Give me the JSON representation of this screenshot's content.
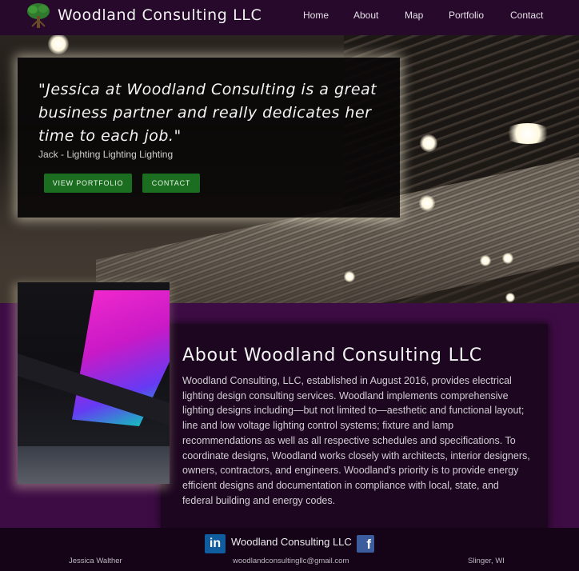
{
  "header": {
    "site_title": "Woodland Consulting LLC",
    "logo_icon": "tree-icon",
    "nav": [
      "Home",
      "About",
      "Map",
      "Portfolio",
      "Contact"
    ]
  },
  "hero": {
    "quote": "\"Jessica at Woodland Consulting is a great business partner and really dedicates her time to each job.\"",
    "author": "Jack - Lighting Lighting Lighting",
    "buttons": {
      "portfolio": "VIEW PORTFOLIO",
      "contact": "CONTACT"
    },
    "button_color": "#1b6d1f"
  },
  "about": {
    "title": "About Woodland Consulting LLC",
    "body": "Woodland Consulting, LLC, established in August 2016, provides electrical lighting design consulting services. Woodland implements comprehensive lighting designs including—but not limited to—aesthetic and functional layout; line and low voltage lighting control systems; fixture and lamp recommendations as well as all respective schedules and specifications. To coordinate designs, Woodland works closely with architects, interior designers, owners, contractors, and engineers. Woodland's priority is to provide energy efficient designs and documentation in compliance with local, state, and federal building and energy codes."
  },
  "footer": {
    "linkedin_icon": "linkedin-icon",
    "linkedin_glyph": "in",
    "brand": "Woodland Consulting LLC",
    "facebook_icon": "facebook-icon",
    "facebook_glyph": "f",
    "name": "Jessica Walther",
    "email": "woodlandconsultingllc@gmail.com",
    "location": "Slinger, WI"
  },
  "colors": {
    "page_background": "#2a0a30",
    "header_background": "#26092b",
    "about_panel": "#1d0620",
    "footer_background": "#150418"
  }
}
